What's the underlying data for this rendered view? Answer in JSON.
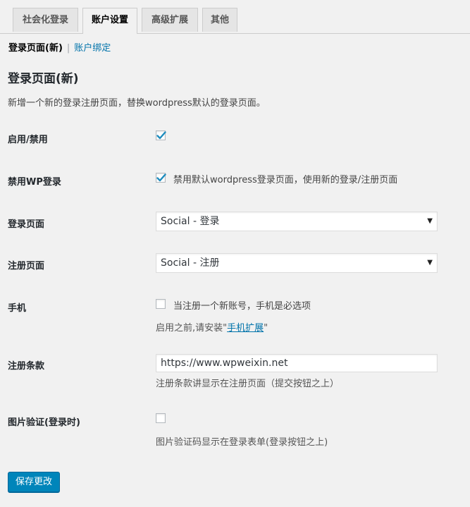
{
  "tabs": [
    {
      "label": "社会化登录",
      "active": false
    },
    {
      "label": "账户设置",
      "active": true
    },
    {
      "label": "高级扩展",
      "active": false
    },
    {
      "label": "其他",
      "active": false
    }
  ],
  "subnav": {
    "current": "登录页面(新)",
    "separator": "|",
    "other": "账户绑定"
  },
  "section": {
    "title": "登录页面(新)",
    "description": "新增一个新的登录注册页面，替换wordpress默认的登录页面。"
  },
  "fields": {
    "enable": {
      "label": "启用/禁用",
      "checked": true
    },
    "disable_wp_login": {
      "label": "禁用WP登录",
      "checked": true,
      "checkbox_text": "禁用默认wordpress登录页面，使用新的登录/注册页面"
    },
    "login_page": {
      "label": "登录页面",
      "selected": "Social - 登录"
    },
    "register_page": {
      "label": "注册页面",
      "selected": "Social - 注册"
    },
    "mobile": {
      "label": "手机",
      "checked": false,
      "checkbox_text": "当注册一个新账号，手机是必选项",
      "help_prefix": "启用之前,请安装\"",
      "help_link": "手机扩展",
      "help_suffix": "\""
    },
    "terms": {
      "label": "注册条款",
      "value": "https://www.wpweixin.net",
      "help": "注册条款讲显示在注册页面（提交按钮之上）"
    },
    "captcha": {
      "label": "图片验证(登录时)",
      "checked": false,
      "help": "图片验证码显示在登录表单(登录按钮之上)"
    }
  },
  "save_button": "保存更改",
  "colors": {
    "accent": "#0085ba",
    "link": "#0073aa",
    "check": "#1e8cbe",
    "background": "#f1f1f1"
  }
}
